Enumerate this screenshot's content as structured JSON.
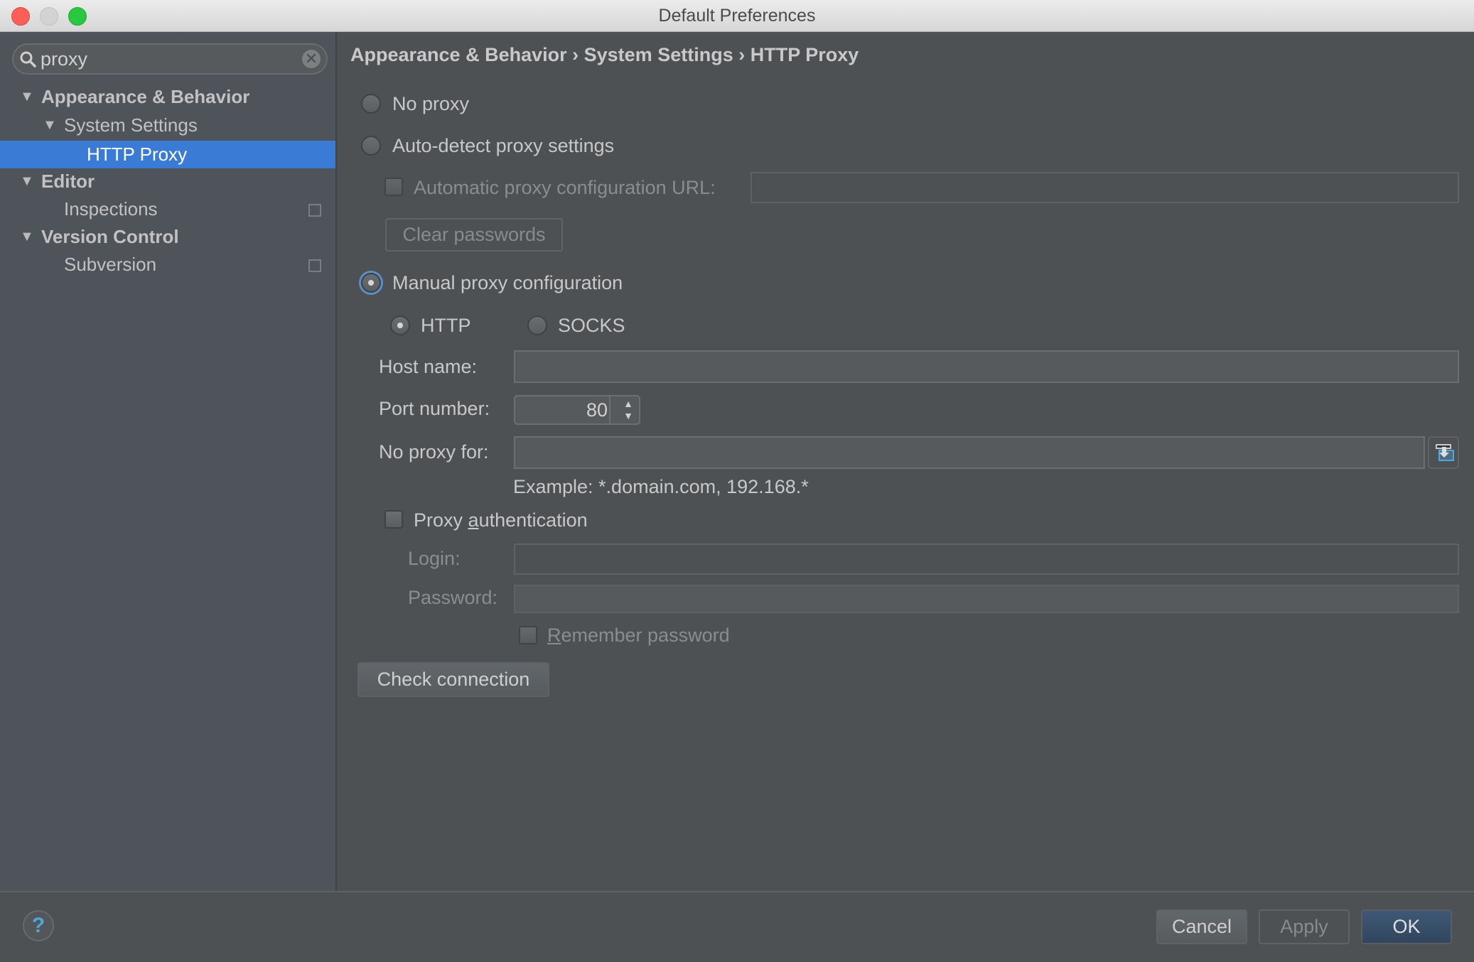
{
  "window": {
    "title": "Default Preferences"
  },
  "search": {
    "value": "proxy",
    "icon": "search-icon",
    "clear_icon": "clear-icon"
  },
  "sidebar": {
    "items": [
      {
        "label": "Appearance & Behavior",
        "level": 0,
        "expanded": true,
        "bold": true
      },
      {
        "label": "System Settings",
        "level": 1,
        "expanded": true,
        "bold": false
      },
      {
        "label": "HTTP Proxy",
        "level": 2,
        "selected": true
      },
      {
        "label": "Editor",
        "level": 0,
        "expanded": true,
        "bold": true
      },
      {
        "label": "Inspections",
        "level": 1,
        "project_icon": true
      },
      {
        "label": "Version Control",
        "level": 0,
        "expanded": true,
        "bold": true
      },
      {
        "label": "Subversion",
        "level": 1,
        "project_icon": true
      }
    ]
  },
  "breadcrumb": {
    "parts": [
      "Appearance & Behavior",
      "System Settings",
      "HTTP Proxy"
    ],
    "separator": "›"
  },
  "proxy": {
    "no_proxy": {
      "label": "No proxy",
      "selected": false
    },
    "auto_detect": {
      "label": "Auto-detect proxy settings",
      "selected": false
    },
    "auto_url": {
      "label": "Automatic proxy configuration URL:",
      "checked": false,
      "value": ""
    },
    "clear_passwords": "Clear passwords",
    "manual": {
      "label": "Manual proxy configuration",
      "selected": true
    },
    "type_http": {
      "label": "HTTP",
      "selected": true
    },
    "type_socks": {
      "label": "SOCKS",
      "selected": false
    },
    "host_label": "Host name:",
    "host_value": "",
    "port_label": "Port number:",
    "port_value": "80",
    "no_proxy_for_label": "No proxy for:",
    "no_proxy_for_value": "",
    "example": "Example: *.domain.com, 192.168.*",
    "auth": {
      "label_pre": "Proxy ",
      "label_mnemonic": "a",
      "label_post": "uthentication",
      "checked": false
    },
    "login_label": "Login:",
    "login_value": "",
    "password_label": "Password:",
    "password_value": "",
    "remember": {
      "label_mnemonic": "R",
      "label_post": "emember password",
      "checked": false
    },
    "check_connection": "Check connection"
  },
  "footer": {
    "help": "?",
    "cancel": "Cancel",
    "apply": "Apply",
    "ok": "OK"
  },
  "colors": {
    "selection": "#3a7bd5",
    "ok_button": "#3a5371",
    "help_icon": "#4ea6d9"
  }
}
